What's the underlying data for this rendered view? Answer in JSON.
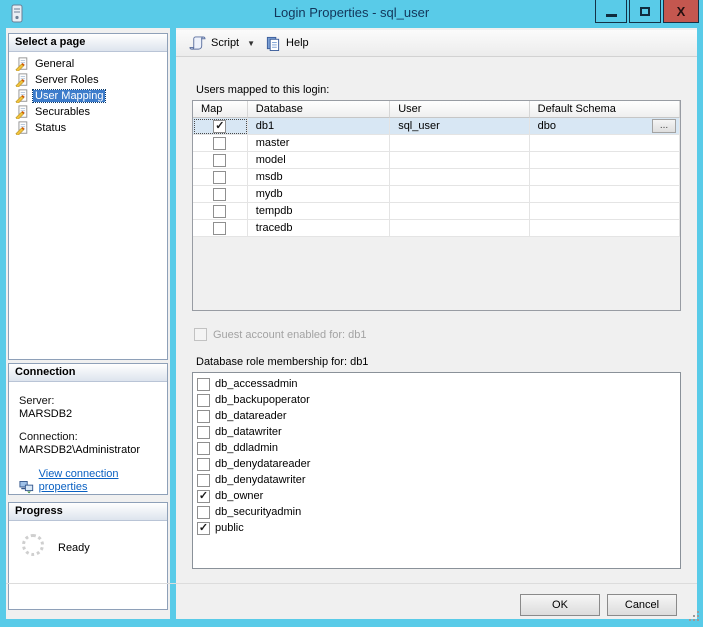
{
  "window": {
    "title": "Login Properties - sql_user"
  },
  "icons": {
    "checkmark": "✓",
    "dropdown_arrow": "▼",
    "close": "X",
    "browse_ellipsis": "..."
  },
  "colors": {
    "titlebar": "#59cbe8",
    "close_button": "#c4574f",
    "selection_blue": "#3d7ccb",
    "link_blue": "#0b61c2",
    "selected_row": "#d8e7f4"
  },
  "toolbar": {
    "script_label": "Script",
    "help_label": "Help"
  },
  "sidebar": {
    "select_page": {
      "header": "Select a page",
      "items": [
        {
          "label": "General",
          "selected": false
        },
        {
          "label": "Server Roles",
          "selected": false
        },
        {
          "label": "User Mapping",
          "selected": true
        },
        {
          "label": "Securables",
          "selected": false
        },
        {
          "label": "Status",
          "selected": false
        }
      ]
    },
    "connection": {
      "header": "Connection",
      "server_label": "Server:",
      "server_value": "MARSDB2",
      "connection_label": "Connection:",
      "connection_value": "MARSDB2\\Administrator",
      "link": "View connection properties"
    },
    "progress": {
      "header": "Progress",
      "status": "Ready"
    }
  },
  "main": {
    "users_mapped_label": "Users mapped to this login:",
    "table": {
      "columns": [
        "Map",
        "Database",
        "User",
        "Default Schema"
      ],
      "rows": [
        {
          "map": true,
          "database": "db1",
          "user": "sql_user",
          "default_schema": "dbo",
          "selected": true
        },
        {
          "map": false,
          "database": "master",
          "user": "",
          "default_schema": "",
          "selected": false
        },
        {
          "map": false,
          "database": "model",
          "user": "",
          "default_schema": "",
          "selected": false
        },
        {
          "map": false,
          "database": "msdb",
          "user": "",
          "default_schema": "",
          "selected": false
        },
        {
          "map": false,
          "database": "mydb",
          "user": "",
          "default_schema": "",
          "selected": false
        },
        {
          "map": false,
          "database": "tempdb",
          "user": "",
          "default_schema": "",
          "selected": false
        },
        {
          "map": false,
          "database": "tracedb",
          "user": "",
          "default_schema": "",
          "selected": false
        }
      ]
    },
    "guest_checkbox_label": "Guest account enabled for: db1",
    "role_membership_label": "Database role membership for: db1",
    "roles": [
      {
        "name": "db_accessadmin",
        "checked": false
      },
      {
        "name": "db_backupoperator",
        "checked": false
      },
      {
        "name": "db_datareader",
        "checked": false
      },
      {
        "name": "db_datawriter",
        "checked": false
      },
      {
        "name": "db_ddladmin",
        "checked": false
      },
      {
        "name": "db_denydatareader",
        "checked": false
      },
      {
        "name": "db_denydatawriter",
        "checked": false
      },
      {
        "name": "db_owner",
        "checked": true
      },
      {
        "name": "db_securityadmin",
        "checked": false
      },
      {
        "name": "public",
        "checked": true
      }
    ]
  },
  "footer": {
    "ok_label": "OK",
    "cancel_label": "Cancel"
  }
}
